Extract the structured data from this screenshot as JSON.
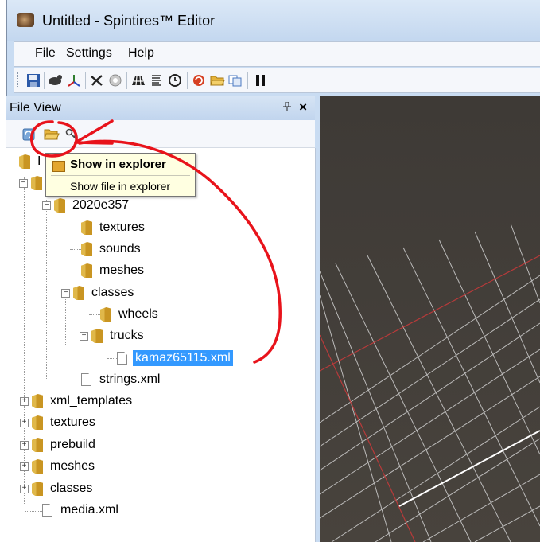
{
  "window": {
    "title": "Untitled - Spintires™ Editor"
  },
  "menu": {
    "items": [
      "File",
      "Settings",
      "Help"
    ]
  },
  "toolbar": {
    "buttons": [
      "save-icon",
      "truck-icon",
      "axes-icon",
      "cross-icon",
      "gear-icon",
      "grid-icon",
      "list-icon",
      "clock-icon",
      "reload-icon",
      "open-folder-icon",
      "copy-icon",
      "pause-icon"
    ]
  },
  "panel": {
    "title": "File View",
    "pin_glyph": "ᵩ",
    "close_glyph": "×"
  },
  "tooltip": {
    "title": "Show in explorer",
    "body": "Show file in explorer"
  },
  "tree": {
    "root_partial": "I",
    "item_2020e357": "2020e357",
    "item_textures": "textures",
    "item_sounds": "sounds",
    "item_meshes": "meshes",
    "item_classes": "classes",
    "item_wheels": "wheels",
    "item_trucks": "trucks",
    "item_kamaz": "kamaz65115.xml",
    "item_strings": "strings.xml",
    "item_xml_templates": "xml_templates",
    "item_textures2": "textures",
    "item_prebuild": "prebuild",
    "item_meshes2": "meshes",
    "item_classes2": "classes",
    "item_media": "media.xml"
  },
  "colors": {
    "selection": "#3399ff",
    "annotation": "#e8131b",
    "viewport": "#433f3a",
    "grid": "#d9d9d9",
    "axis": "#c03a3a"
  }
}
